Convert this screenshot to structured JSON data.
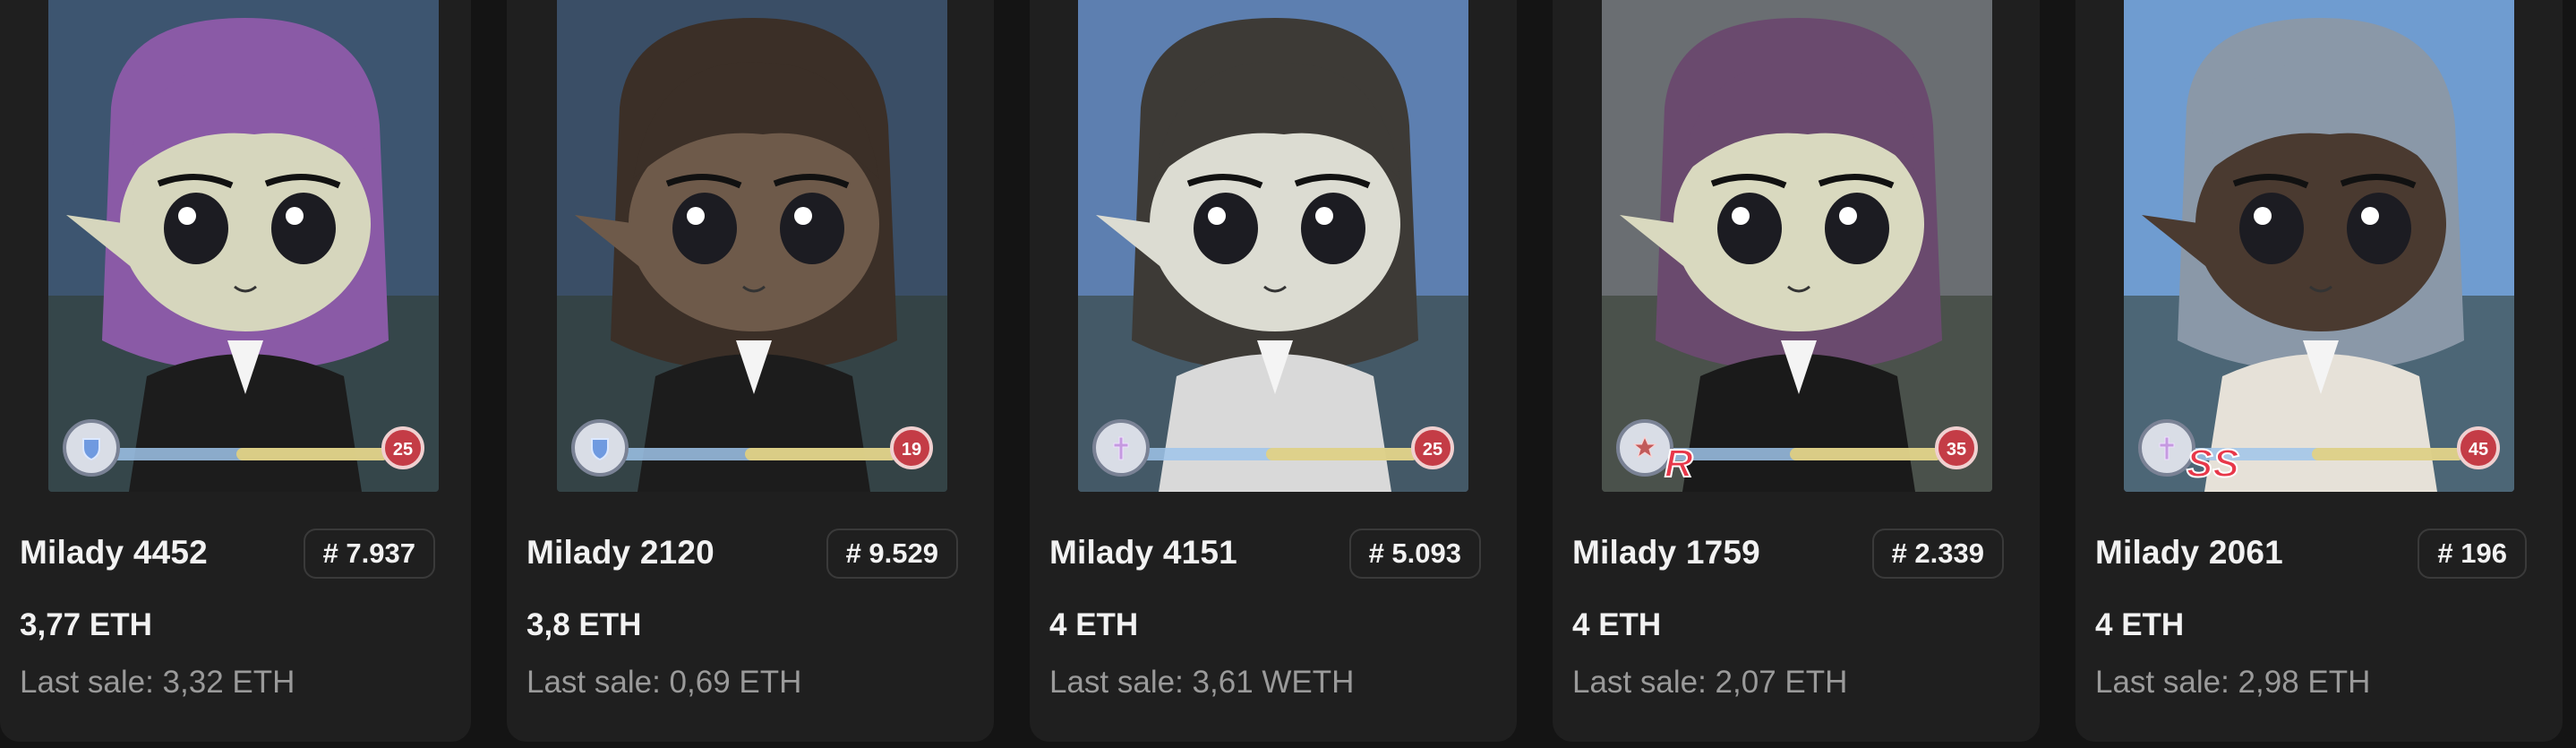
{
  "cards": [
    {
      "name": "Milady 4452",
      "rank": "# 7.937",
      "price": "3,77 ETH",
      "last_sale": "Last sale: 3,32 ETH",
      "bg": "#3d5570",
      "hair": "#8a5aa6",
      "skin": "#d6d6bd",
      "outfit": "#1c1c1c",
      "level": "25",
      "badge_icon": "shield-icon"
    },
    {
      "name": "Milady 2120",
      "rank": "# 9.529",
      "price": "3,8 ETH",
      "last_sale": "Last sale: 0,69 ETH",
      "bg": "#3a4e66",
      "hair": "#3b2f27",
      "skin": "#6e5a4a",
      "outfit": "#1c1c1c",
      "level": "19",
      "badge_icon": "shield-icon"
    },
    {
      "name": "Milady 4151",
      "rank": "# 5.093",
      "price": "4 ETH",
      "last_sale": "Last sale: 3,61 WETH",
      "bg": "#5d7fb0",
      "hair": "#3d3a36",
      "skin": "#dcdcd2",
      "outfit": "#d9d9d9",
      "level": "25",
      "badge_icon": "cross-icon"
    },
    {
      "name": "Milady 1759",
      "rank": "# 2.339",
      "price": "4 ETH",
      "last_sale": "Last sale: 2,07 ETH",
      "bg": "#6a6e72",
      "hair": "#6a4a6e",
      "skin": "#d9d9bf",
      "outfit": "#1a1a1a",
      "level": "35",
      "badge_icon": "star-icon",
      "tier": "R"
    },
    {
      "name": "Milady 2061",
      "rank": "# 196",
      "price": "4 ETH",
      "last_sale": "Last sale: 2,98 ETH",
      "bg": "#6f9cd0",
      "hair": "#8a98a8",
      "skin": "#4a3a30",
      "outfit": "#e6e1d8",
      "level": "45",
      "badge_icon": "cross-icon",
      "tier": "SS"
    }
  ]
}
